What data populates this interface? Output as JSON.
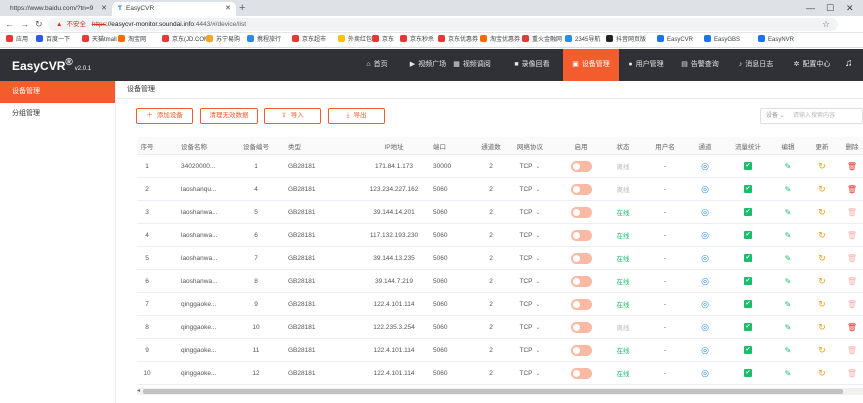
{
  "browser": {
    "tabs": [
      {
        "title": "https://www.baidu.com/?tn=9"
      },
      {
        "title": "EasyCVR"
      }
    ],
    "address": {
      "insecure_label": "不安全",
      "scheme": "https",
      "host": "://easycvr-monitor.soundai.info",
      "path": ":4443/#/device/list"
    },
    "bookmarks": [
      {
        "label": "应用",
        "color": "#e53935"
      },
      {
        "label": "百度一下",
        "color": "#2b5ce6"
      },
      {
        "label": "天猫tmall",
        "color": "#e53935"
      },
      {
        "label": "淘宝网",
        "color": "#ff6a00"
      },
      {
        "label": "京东(JD.COM)",
        "color": "#e53935"
      },
      {
        "label": "苏宁易购",
        "color": "#f5a623"
      },
      {
        "label": "携程旅行",
        "color": "#2b8ce6"
      },
      {
        "label": "京东超市",
        "color": "#e53935"
      },
      {
        "label": "外卖红包",
        "color": "#ffc107"
      },
      {
        "label": "京东",
        "color": "#e53935"
      },
      {
        "label": "京东秒杀",
        "color": "#e53935"
      },
      {
        "label": "京东优惠券",
        "color": "#e53935"
      },
      {
        "label": "淘宝优惠券",
        "color": "#ff6a00"
      },
      {
        "label": "重火金融网",
        "color": "#e53935"
      },
      {
        "label": "2345导航",
        "color": "#2b8ce6"
      },
      {
        "label": "抖音网页版",
        "color": "#222222"
      },
      {
        "label": "EasyCVR",
        "color": "#1a73e8"
      },
      {
        "label": "EasyGBS",
        "color": "#1a73e8"
      },
      {
        "label": "EasyNVR",
        "color": "#1a73e8"
      }
    ]
  },
  "app": {
    "brand": "EasyCVR",
    "reg": "®",
    "version": "v2.0.1",
    "nav": [
      {
        "label": "首页",
        "icon": "⌂"
      },
      {
        "label": "视频广场",
        "icon": "▶"
      },
      {
        "label": "视频调阅",
        "icon": "▦"
      },
      {
        "label": "录像回看",
        "icon": "■"
      },
      {
        "label": "设备管理",
        "icon": "▣"
      },
      {
        "label": "用户管理",
        "icon": "●"
      },
      {
        "label": "告警查询",
        "icon": "▤"
      },
      {
        "label": "消息日志",
        "icon": "♪"
      },
      {
        "label": "配置中心",
        "icon": "✲"
      }
    ],
    "accent": "#f35c2c"
  },
  "sidebar": {
    "items": [
      {
        "label": "设备管理"
      },
      {
        "label": "分组管理"
      }
    ]
  },
  "page": {
    "title": "设备管理",
    "buttons": {
      "add": "添加设备",
      "clean": "清理无效数据",
      "import": "导入",
      "export": "导出"
    },
    "filter": {
      "select": "设备",
      "placeholder": "请输入搜索内容"
    }
  },
  "table": {
    "headers": [
      "序号",
      "设备名称",
      "设备编号",
      "类型",
      "IP地址",
      "端口",
      "通道数",
      "网络协议",
      "启用",
      "状态",
      "用户名",
      "通道",
      "流量统计",
      "编辑",
      "更新",
      "删除"
    ],
    "rows": [
      {
        "no": "1",
        "name": "34020000...",
        "id": "1",
        "type": "GB28181",
        "ip": "171.84.1.173",
        "port": "30000",
        "channels": "2",
        "proto": "TCP",
        "status": "离线",
        "online": false,
        "user": "-",
        "del_active": true
      },
      {
        "no": "2",
        "name": "laoshanqu...",
        "id": "4",
        "type": "GB28181",
        "ip": "123.234.227.162",
        "port": "5060",
        "channels": "2",
        "proto": "TCP",
        "status": "离线",
        "online": false,
        "user": "-",
        "del_active": true
      },
      {
        "no": "3",
        "name": "laoshanwa...",
        "id": "5",
        "type": "GB28181",
        "ip": "39.144.14.201",
        "port": "5060",
        "channels": "2",
        "proto": "TCP",
        "status": "在线",
        "online": true,
        "user": "-",
        "del_active": false
      },
      {
        "no": "4",
        "name": "laoshanwa...",
        "id": "6",
        "type": "GB28181",
        "ip": "117.132.193.230",
        "port": "5060",
        "channels": "2",
        "proto": "TCP",
        "status": "在线",
        "online": true,
        "user": "-",
        "del_active": false
      },
      {
        "no": "5",
        "name": "laoshanwa...",
        "id": "7",
        "type": "GB28181",
        "ip": "39.144.13.235",
        "port": "5060",
        "channels": "2",
        "proto": "TCP",
        "status": "在线",
        "online": true,
        "user": "-",
        "del_active": false
      },
      {
        "no": "6",
        "name": "laoshanwa...",
        "id": "8",
        "type": "GB28181",
        "ip": "39.144.7.219",
        "port": "5060",
        "channels": "2",
        "proto": "TCP",
        "status": "在线",
        "online": true,
        "user": "-",
        "del_active": false
      },
      {
        "no": "7",
        "name": "qinggaoke...",
        "id": "9",
        "type": "GB28181",
        "ip": "122.4.101.114",
        "port": "5060",
        "channels": "2",
        "proto": "TCP",
        "status": "在线",
        "online": true,
        "user": "-",
        "del_active": false
      },
      {
        "no": "8",
        "name": "qinggaoke...",
        "id": "10",
        "type": "GB28181",
        "ip": "122.235.3.254",
        "port": "5060",
        "channels": "2",
        "proto": "TCP",
        "status": "离线",
        "online": false,
        "user": "-",
        "del_active": true
      },
      {
        "no": "9",
        "name": "qinggaoke...",
        "id": "11",
        "type": "GB28181",
        "ip": "122.4.101.114",
        "port": "5060",
        "channels": "2",
        "proto": "TCP",
        "status": "在线",
        "online": true,
        "user": "-",
        "del_active": false
      },
      {
        "no": "10",
        "name": "qinggaoke...",
        "id": "12",
        "type": "GB28181",
        "ip": "122.4.101.114",
        "port": "5060",
        "channels": "2",
        "proto": "TCP",
        "status": "在线",
        "online": true,
        "user": "-",
        "del_active": false
      }
    ]
  }
}
